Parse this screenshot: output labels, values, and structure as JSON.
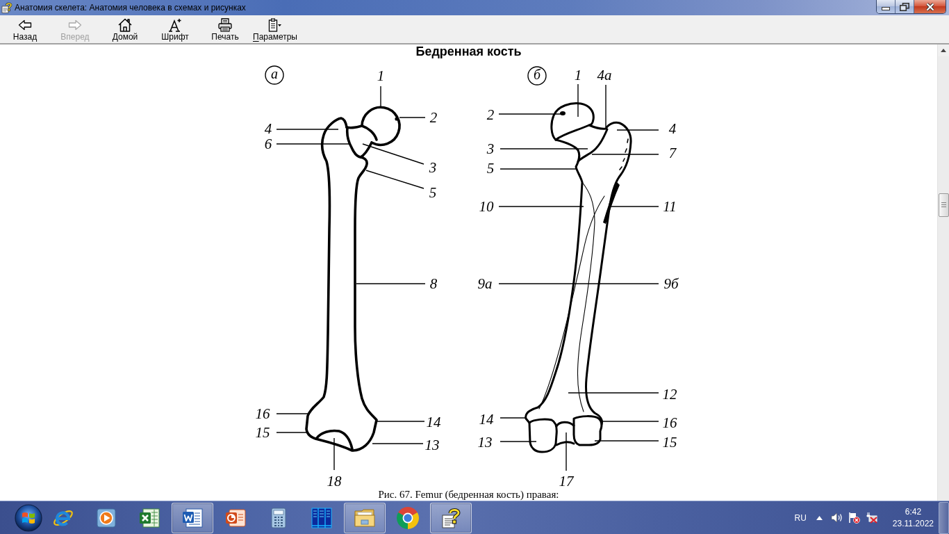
{
  "window": {
    "title": "Анатомия скелета: Анатомия человека в схемах и рисунках"
  },
  "toolbar": [
    {
      "kind": "back",
      "label": "Назад",
      "disabled": false
    },
    {
      "kind": "forward",
      "label": "Вперед",
      "disabled": true
    },
    {
      "kind": "home",
      "label": "Домой",
      "disabled": false
    },
    {
      "kind": "font",
      "label": "Шрифт",
      "disabled": false
    },
    {
      "kind": "print",
      "label": "Печать",
      "disabled": false
    },
    {
      "kind": "options",
      "label": "Параметры",
      "disabled": false,
      "access_key_underlined": true
    }
  ],
  "document": {
    "heading": "Бедренная кость",
    "figure": {
      "panels": [
        {
          "kind": "front",
          "tag": "а",
          "labels": [
            "1",
            "2",
            "4",
            "6",
            "3",
            "5",
            "8",
            "16",
            "15",
            "14",
            "13",
            "18"
          ]
        },
        {
          "kind": "back",
          "tag": "б",
          "labels": [
            "1",
            "4а",
            "2",
            "4",
            "3",
            "7",
            "5",
            "10",
            "11",
            "9а",
            "9б",
            "12",
            "14",
            "16",
            "13",
            "15",
            "17"
          ]
        }
      ],
      "caption": "Рис. 67. Femur (бедренная кость) правая:"
    }
  },
  "taskbar": {
    "apps": [
      {
        "kind": "ie",
        "open": false
      },
      {
        "kind": "media",
        "open": false
      },
      {
        "kind": "excel",
        "open": false
      },
      {
        "kind": "word",
        "open": true
      },
      {
        "kind": "powerpoint",
        "open": false
      },
      {
        "kind": "calculator",
        "open": false
      },
      {
        "kind": "bookshelf",
        "open": false
      },
      {
        "kind": "explorer",
        "open": true
      },
      {
        "kind": "chrome",
        "open": false
      },
      {
        "kind": "help",
        "open": true
      }
    ],
    "tray": {
      "language": "RU",
      "time": "6:42",
      "date": "23.11.2022"
    }
  }
}
